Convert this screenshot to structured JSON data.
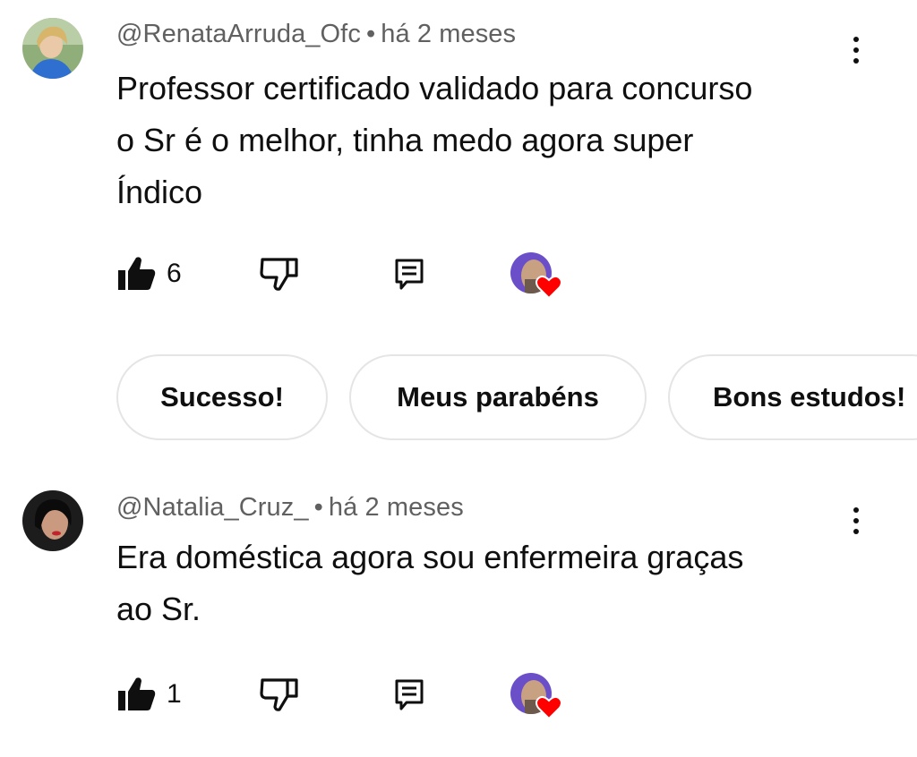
{
  "comments": [
    {
      "author": "@RenataArruda_Ofc",
      "separator": "•",
      "time": "há 2 meses",
      "text_lines": [
        "Professor certificado validado para concurso",
        "o Sr é o melhor, tinha medo agora super",
        "Índico"
      ],
      "likes": "6"
    },
    {
      "author": "@Natalia_Cruz_",
      "separator": "•",
      "time": "há 2 meses",
      "text_lines": [
        "Era doméstica agora sou enfermeira graças",
        "ao Sr."
      ],
      "likes": "1"
    }
  ],
  "suggested_replies": [
    "Sucesso!",
    "Meus parabéns",
    "Bons estudos!"
  ],
  "icons": {
    "like": "thumbs-up-filled-icon",
    "dislike": "thumbs-down-outline-icon",
    "reply": "reply-comment-icon",
    "menu": "more-vertical-icon",
    "creator_heart": "creator-heart-icon"
  },
  "colors": {
    "text": "#0f0f0f",
    "meta": "#606060",
    "heart": "#ff0000",
    "chip_border": "#e5e5e5"
  }
}
